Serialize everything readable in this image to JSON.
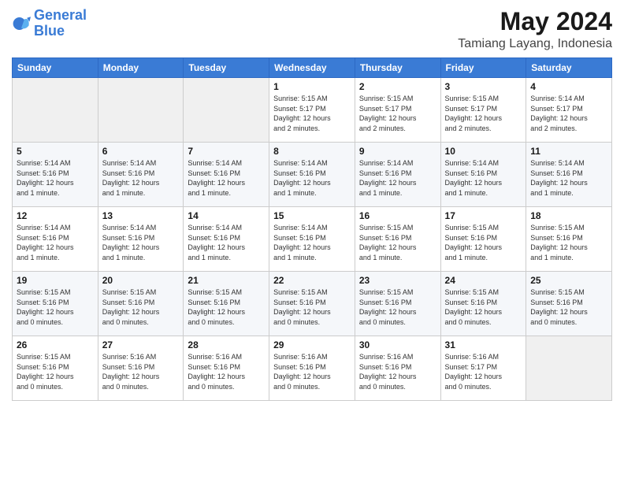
{
  "header": {
    "logo_general": "General",
    "logo_blue": "Blue",
    "month_title": "May 2024",
    "location": "Tamiang Layang, Indonesia"
  },
  "weekdays": [
    "Sunday",
    "Monday",
    "Tuesday",
    "Wednesday",
    "Thursday",
    "Friday",
    "Saturday"
  ],
  "weeks": [
    [
      {
        "day": "",
        "info": ""
      },
      {
        "day": "",
        "info": ""
      },
      {
        "day": "",
        "info": ""
      },
      {
        "day": "1",
        "info": "Sunrise: 5:15 AM\nSunset: 5:17 PM\nDaylight: 12 hours\nand 2 minutes."
      },
      {
        "day": "2",
        "info": "Sunrise: 5:15 AM\nSunset: 5:17 PM\nDaylight: 12 hours\nand 2 minutes."
      },
      {
        "day": "3",
        "info": "Sunrise: 5:15 AM\nSunset: 5:17 PM\nDaylight: 12 hours\nand 2 minutes."
      },
      {
        "day": "4",
        "info": "Sunrise: 5:14 AM\nSunset: 5:17 PM\nDaylight: 12 hours\nand 2 minutes."
      }
    ],
    [
      {
        "day": "5",
        "info": "Sunrise: 5:14 AM\nSunset: 5:16 PM\nDaylight: 12 hours\nand 1 minute."
      },
      {
        "day": "6",
        "info": "Sunrise: 5:14 AM\nSunset: 5:16 PM\nDaylight: 12 hours\nand 1 minute."
      },
      {
        "day": "7",
        "info": "Sunrise: 5:14 AM\nSunset: 5:16 PM\nDaylight: 12 hours\nand 1 minute."
      },
      {
        "day": "8",
        "info": "Sunrise: 5:14 AM\nSunset: 5:16 PM\nDaylight: 12 hours\nand 1 minute."
      },
      {
        "day": "9",
        "info": "Sunrise: 5:14 AM\nSunset: 5:16 PM\nDaylight: 12 hours\nand 1 minute."
      },
      {
        "day": "10",
        "info": "Sunrise: 5:14 AM\nSunset: 5:16 PM\nDaylight: 12 hours\nand 1 minute."
      },
      {
        "day": "11",
        "info": "Sunrise: 5:14 AM\nSunset: 5:16 PM\nDaylight: 12 hours\nand 1 minute."
      }
    ],
    [
      {
        "day": "12",
        "info": "Sunrise: 5:14 AM\nSunset: 5:16 PM\nDaylight: 12 hours\nand 1 minute."
      },
      {
        "day": "13",
        "info": "Sunrise: 5:14 AM\nSunset: 5:16 PM\nDaylight: 12 hours\nand 1 minute."
      },
      {
        "day": "14",
        "info": "Sunrise: 5:14 AM\nSunset: 5:16 PM\nDaylight: 12 hours\nand 1 minute."
      },
      {
        "day": "15",
        "info": "Sunrise: 5:14 AM\nSunset: 5:16 PM\nDaylight: 12 hours\nand 1 minute."
      },
      {
        "day": "16",
        "info": "Sunrise: 5:15 AM\nSunset: 5:16 PM\nDaylight: 12 hours\nand 1 minute."
      },
      {
        "day": "17",
        "info": "Sunrise: 5:15 AM\nSunset: 5:16 PM\nDaylight: 12 hours\nand 1 minute."
      },
      {
        "day": "18",
        "info": "Sunrise: 5:15 AM\nSunset: 5:16 PM\nDaylight: 12 hours\nand 1 minute."
      }
    ],
    [
      {
        "day": "19",
        "info": "Sunrise: 5:15 AM\nSunset: 5:16 PM\nDaylight: 12 hours\nand 0 minutes."
      },
      {
        "day": "20",
        "info": "Sunrise: 5:15 AM\nSunset: 5:16 PM\nDaylight: 12 hours\nand 0 minutes."
      },
      {
        "day": "21",
        "info": "Sunrise: 5:15 AM\nSunset: 5:16 PM\nDaylight: 12 hours\nand 0 minutes."
      },
      {
        "day": "22",
        "info": "Sunrise: 5:15 AM\nSunset: 5:16 PM\nDaylight: 12 hours\nand 0 minutes."
      },
      {
        "day": "23",
        "info": "Sunrise: 5:15 AM\nSunset: 5:16 PM\nDaylight: 12 hours\nand 0 minutes."
      },
      {
        "day": "24",
        "info": "Sunrise: 5:15 AM\nSunset: 5:16 PM\nDaylight: 12 hours\nand 0 minutes."
      },
      {
        "day": "25",
        "info": "Sunrise: 5:15 AM\nSunset: 5:16 PM\nDaylight: 12 hours\nand 0 minutes."
      }
    ],
    [
      {
        "day": "26",
        "info": "Sunrise: 5:15 AM\nSunset: 5:16 PM\nDaylight: 12 hours\nand 0 minutes."
      },
      {
        "day": "27",
        "info": "Sunrise: 5:16 AM\nSunset: 5:16 PM\nDaylight: 12 hours\nand 0 minutes."
      },
      {
        "day": "28",
        "info": "Sunrise: 5:16 AM\nSunset: 5:16 PM\nDaylight: 12 hours\nand 0 minutes."
      },
      {
        "day": "29",
        "info": "Sunrise: 5:16 AM\nSunset: 5:16 PM\nDaylight: 12 hours\nand 0 minutes."
      },
      {
        "day": "30",
        "info": "Sunrise: 5:16 AM\nSunset: 5:16 PM\nDaylight: 12 hours\nand 0 minutes."
      },
      {
        "day": "31",
        "info": "Sunrise: 5:16 AM\nSunset: 5:17 PM\nDaylight: 12 hours\nand 0 minutes."
      },
      {
        "day": "",
        "info": ""
      }
    ]
  ]
}
